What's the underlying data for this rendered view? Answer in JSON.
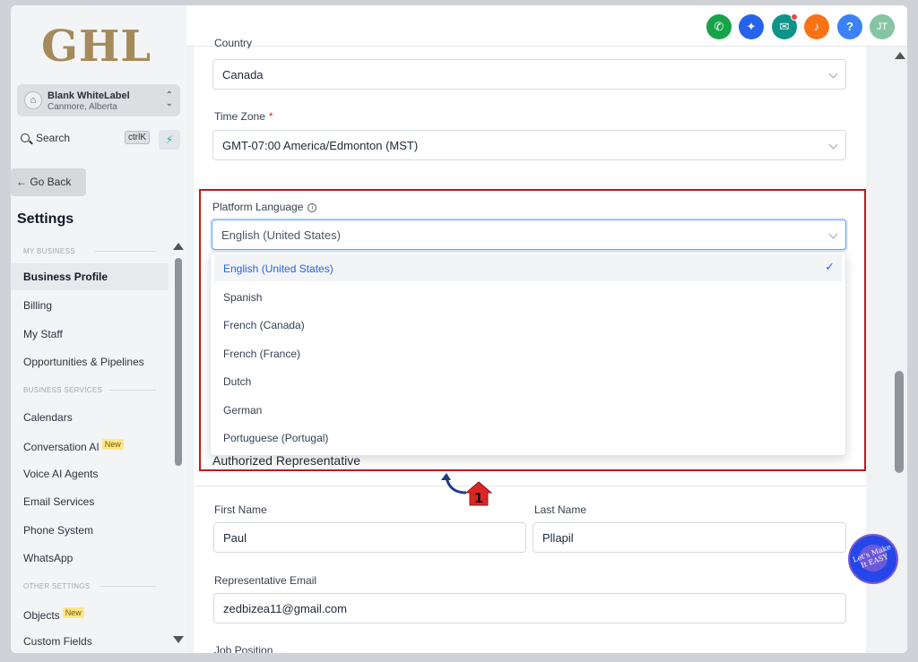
{
  "sidebar": {
    "logo": "GHL",
    "location": {
      "name": "Blank WhiteLabel",
      "sub": "Canmore, Alberta"
    },
    "search": {
      "label": "Search",
      "shortcut": "ctrlK"
    },
    "go_back": "← Go Back",
    "title": "Settings",
    "sections": {
      "my_business": "MY BUSINESS",
      "business_services": "BUSINESS SERVICES",
      "other_settings": "OTHER SETTINGS"
    },
    "items": [
      {
        "label": "Business Profile"
      },
      {
        "label": "Billing"
      },
      {
        "label": "My Staff"
      },
      {
        "label": "Opportunities & Pipelines"
      },
      {
        "label": "Calendars"
      },
      {
        "label": "Conversation AI",
        "badge": "New"
      },
      {
        "label": "Voice AI Agents"
      },
      {
        "label": "Email Services"
      },
      {
        "label": "Phone System"
      },
      {
        "label": "WhatsApp"
      },
      {
        "label": "Objects",
        "badge": "New"
      },
      {
        "label": "Custom Fields"
      }
    ]
  },
  "header": {
    "avatar_initials": "JT",
    "help_label": "?",
    "icon_colors": {
      "phone": "#16a34a",
      "ai": "#2563eb",
      "announce": "#0d9488",
      "notifications": "#f97316",
      "help": "#3b82f6",
      "avatar": "#86c5a4"
    }
  },
  "form": {
    "country": {
      "label": "Country",
      "value": "Canada"
    },
    "timezone": {
      "label": "Time Zone",
      "required_mark": "*",
      "value": "GMT-07:00 America/Edmonton (MST)"
    },
    "platform_language": {
      "label": "Platform Language",
      "value": "English (United States)",
      "options": [
        "English (United States)",
        "Spanish",
        "French (Canada)",
        "French (France)",
        "Dutch",
        "German",
        "Portuguese (Portugal)"
      ],
      "selected_index": 0
    },
    "authorized_rep": {
      "title": "Authorized Representative",
      "first_name": {
        "label": "First Name",
        "value": "Paul"
      },
      "last_name": {
        "label": "Last Name",
        "value": "Pllapil"
      },
      "email": {
        "label": "Representative Email",
        "value": "zedbizea11@gmail.com"
      },
      "job_position": {
        "label": "Job Position"
      }
    }
  },
  "annotation": {
    "number": "1"
  },
  "fab": {
    "text": "Let's Make It EASY"
  },
  "colors": {
    "highlight": "#b91c1c",
    "accent": "#2563eb",
    "badge": "#fde68a"
  }
}
